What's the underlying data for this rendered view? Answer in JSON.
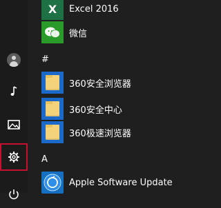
{
  "sidebar": {
    "items": [
      {
        "name": "user-avatar",
        "label": "User"
      },
      {
        "name": "music-icon",
        "label": "Music"
      },
      {
        "name": "photos-icon",
        "label": "Pictures"
      },
      {
        "name": "gear-icon",
        "label": "Settings"
      },
      {
        "name": "power-icon",
        "label": "Power"
      }
    ]
  },
  "apps": [
    {
      "label": "Excel 2016",
      "icon": "excel-icon"
    },
    {
      "label": "微信",
      "icon": "wechat-icon"
    }
  ],
  "sections": [
    {
      "header": "#",
      "items": [
        {
          "label": "360安全浏览器",
          "icon": "folder-icon"
        },
        {
          "label": "360安全中心",
          "icon": "folder-icon"
        },
        {
          "label": "360极速浏览器",
          "icon": "folder-icon"
        }
      ]
    },
    {
      "header": "A",
      "items": [
        {
          "label": "Apple Software Update",
          "icon": "apple-update-icon"
        }
      ]
    }
  ],
  "colors": {
    "background": "#1f1f1f",
    "highlight": "#c8102e",
    "excel": "#1e7145",
    "wechat": "#2a9a2a",
    "folder_tile": "#1b6ac9",
    "folder": "#f3d27a"
  }
}
